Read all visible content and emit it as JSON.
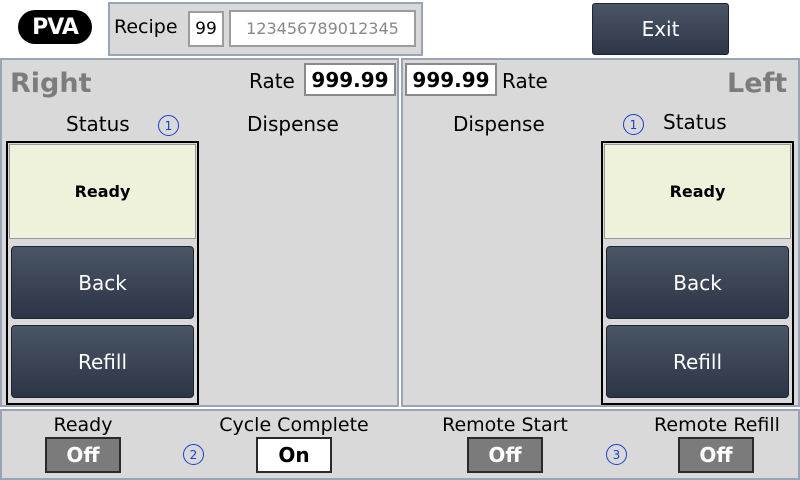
{
  "header": {
    "logo_text": "PVA",
    "recipe_label": "Recipe",
    "recipe_number": "99",
    "recipe_name_placeholder": "123456789012345",
    "exit_label": "Exit"
  },
  "right_panel": {
    "title": "Right",
    "rate_label": "Rate",
    "rate_value": "999.99",
    "status_label": "Status",
    "status_marker": "1",
    "dispense_label": "Dispense",
    "status_text": "Ready",
    "back_label": "Back",
    "refill_label": "Refill"
  },
  "left_panel": {
    "title": "Left",
    "rate_label": "Rate",
    "rate_value": "999.99",
    "status_label": "Status",
    "status_marker": "1",
    "dispense_label": "Dispense",
    "status_text": "Ready",
    "back_label": "Back",
    "refill_label": "Refill"
  },
  "io": {
    "ready": {
      "label": "Ready",
      "state": "Off"
    },
    "marker_2": "2",
    "cycle_complete": {
      "label": "Cycle Complete",
      "state": "On"
    },
    "remote_start": {
      "label": "Remote Start",
      "state": "Off"
    },
    "marker_3": "3",
    "remote_refill": {
      "label": "Remote Refill",
      "state": "Off"
    }
  },
  "colors": {
    "panel_bg": "#d9d9d9",
    "panel_border": "#9aa4b8",
    "button_dark": "#3a4456",
    "status_ready_bg": "#eff2da",
    "indicator_off": "#7b7b7b",
    "indicator_on": "#ffffff",
    "marker_blue": "#1a3ed1"
  }
}
